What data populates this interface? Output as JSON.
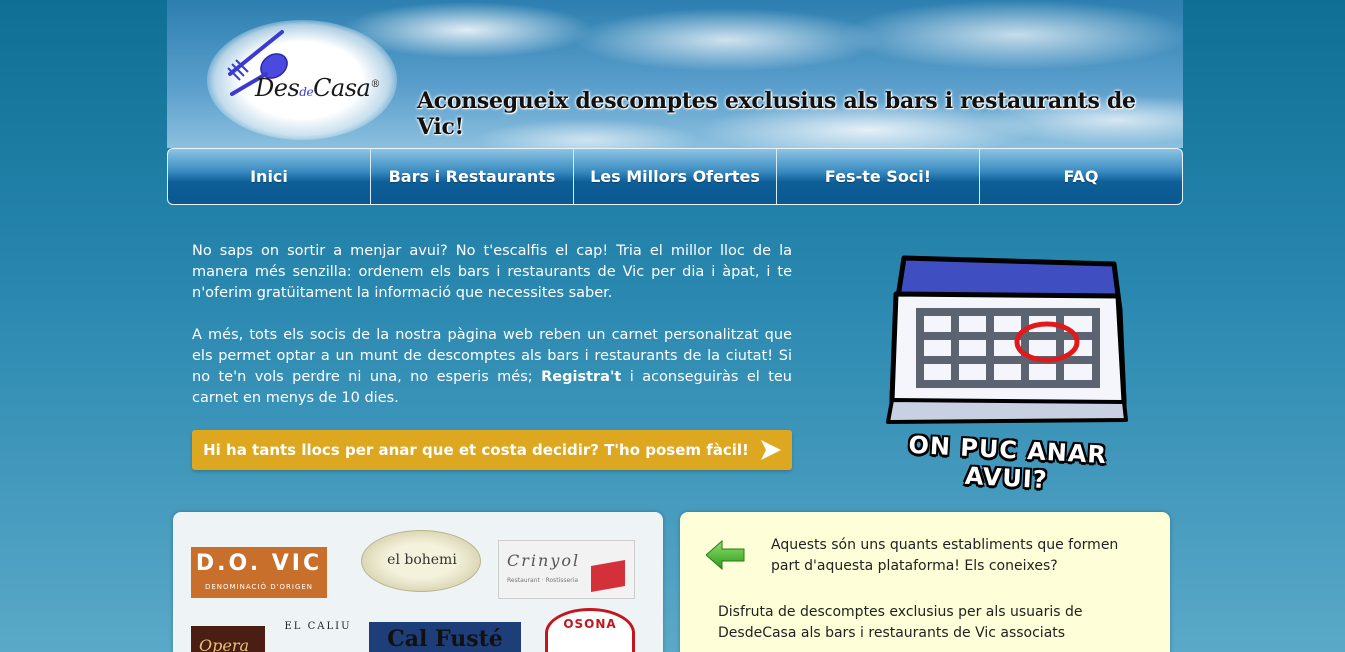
{
  "header": {
    "logo": {
      "part1": "Des",
      "part2": "de",
      "part3": "Casa",
      "mark": "®"
    },
    "tagline": "Aconsegueix descomptes exclusius als bars i restaurants de Vic!"
  },
  "nav": {
    "items": [
      "Inici",
      "Bars i Restaurants",
      "Les Millors Ofertes",
      "Fes-te Soci!",
      "FAQ"
    ]
  },
  "intro": {
    "p1": "No saps on sortir a menjar avui? No t'escalfis el cap! Tria el millor lloc de la manera més senzilla: ordenem els bars i restaurants de Vic per dia i àpat, i te n'oferim gratüitament la informació que necessites saber.",
    "p2_start": "A més, tots els socis de la nostra pàgina web reben un carnet personalitzat que els permet optar a un munt de descomptes als bars i restaurants de la ciutat! Si no te'n vols perdre ni una, no esperis més; ",
    "p2_link": "Registra't",
    "p2_end": " i aconseguiràs el teu carnet en menys de 10 dies."
  },
  "cta": {
    "label": "Hi ha tants llocs per anar que et costa decidir? T'ho posem fàcil!"
  },
  "calendar": {
    "caption": "ON PUC ANAR AVUI?"
  },
  "restaurants": {
    "do_vic": {
      "name": "D.O. VIC",
      "subtitle": "DENOMINACIÓ D'ORIGEN"
    },
    "bohemi": {
      "name": "el bohemi"
    },
    "crinyol": {
      "name": "Crinyol",
      "subtitle": "Restaurant · Rostisseria"
    },
    "opera": {
      "name": "Opera"
    },
    "caliu": {
      "name": "EL CALIU"
    },
    "fuste": {
      "name": "Cal Fusté"
    },
    "osona": {
      "name": "OSONA"
    }
  },
  "info": {
    "line1": "Aquests són uns quants establiments que formen part d'aquesta plataforma! Els coneixes?",
    "line2": "Disfruta de descomptes exclusius per als usuaris de DesdeCasa als bars i restaurants de Vic associats"
  },
  "colors": {
    "accent": "#dda71f",
    "nav": "#0e5f98",
    "info_bg": "#fefed8"
  }
}
